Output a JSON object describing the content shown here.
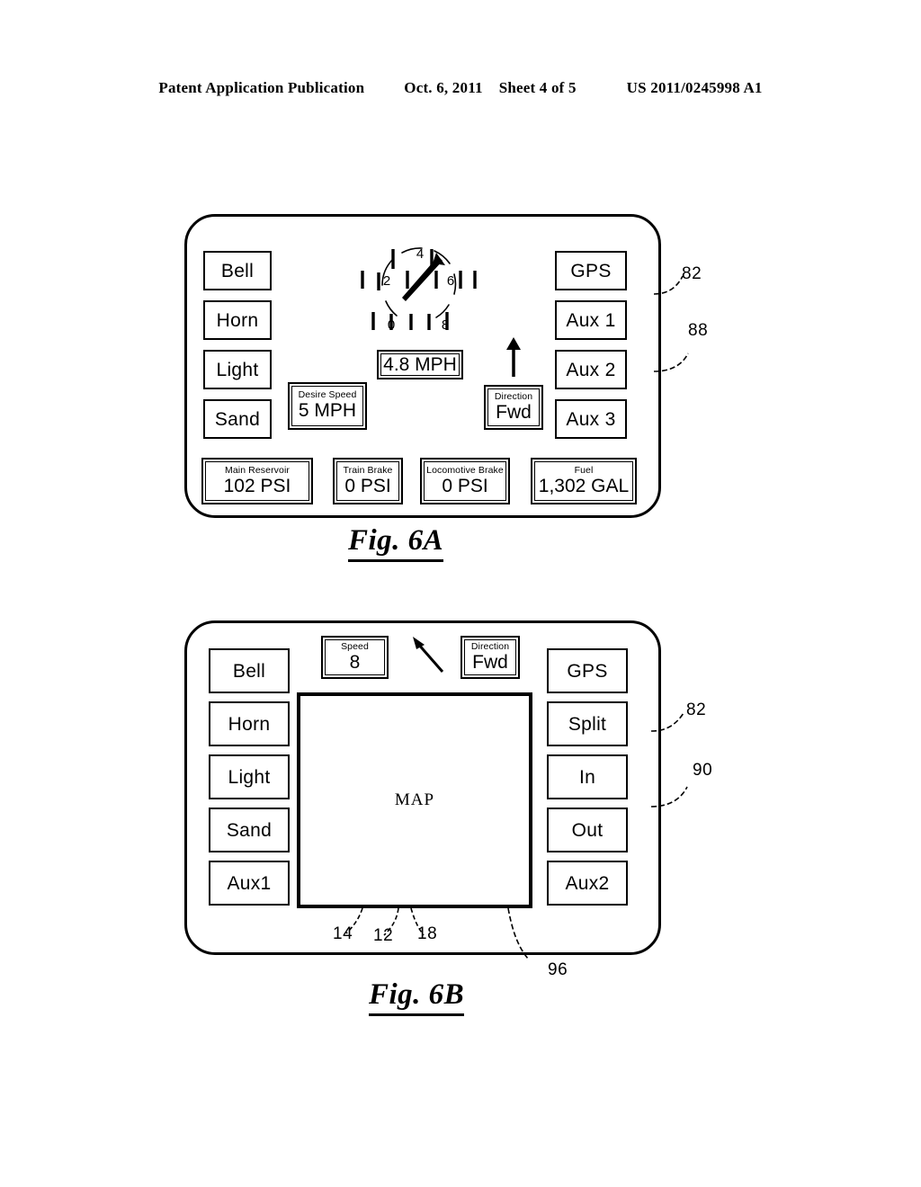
{
  "header": {
    "left": "Patent Application Publication",
    "date": "Oct. 6, 2011",
    "sheet": "Sheet 4 of 5",
    "publication_number": "US 2011/0245998 A1"
  },
  "fig6a": {
    "caption": "Fig. 6A",
    "left_buttons": [
      {
        "label": "Bell"
      },
      {
        "label": "Horn"
      },
      {
        "label": "Light"
      },
      {
        "label": "Sand"
      }
    ],
    "right_buttons": [
      {
        "label": "GPS"
      },
      {
        "label": "Aux 1"
      },
      {
        "label": "Aux 2"
      },
      {
        "label": "Aux 3"
      }
    ],
    "gauge": {
      "tick_labels": [
        "0",
        "2",
        "4",
        "6",
        "8"
      ],
      "needle_value": "4.8",
      "speed_readout": "4.8 MPH"
    },
    "desire_speed": {
      "label": "Desire Speed",
      "value": "5 MPH"
    },
    "direction": {
      "label": "Direction",
      "value": "Fwd"
    },
    "status_boxes": [
      {
        "label": "Main Reservoir",
        "value": "102 PSI"
      },
      {
        "label": "Train Brake",
        "value": "0 PSI"
      },
      {
        "label": "Locomotive Brake",
        "value": "0 PSI"
      },
      {
        "label": "Fuel",
        "value": "1,302 GAL"
      }
    ],
    "ref_numerals": [
      {
        "value": "82"
      },
      {
        "value": "88"
      }
    ]
  },
  "fig6b": {
    "caption": "Fig. 6B",
    "left_buttons": [
      {
        "label": "Bell"
      },
      {
        "label": "Horn"
      },
      {
        "label": "Light"
      },
      {
        "label": "Sand"
      },
      {
        "label": "Aux1"
      }
    ],
    "right_buttons": [
      {
        "label": "GPS"
      },
      {
        "label": "Split"
      },
      {
        "label": "In"
      },
      {
        "label": "Out"
      },
      {
        "label": "Aux2"
      }
    ],
    "speed": {
      "label": "Speed",
      "value": "8"
    },
    "direction": {
      "label": "Direction",
      "value": "Fwd"
    },
    "map": {
      "label": "MAP"
    },
    "ref_numerals": [
      {
        "value": "82"
      },
      {
        "value": "90"
      },
      {
        "value": "14"
      },
      {
        "value": "12"
      },
      {
        "value": "18"
      },
      {
        "value": "96"
      }
    ]
  }
}
